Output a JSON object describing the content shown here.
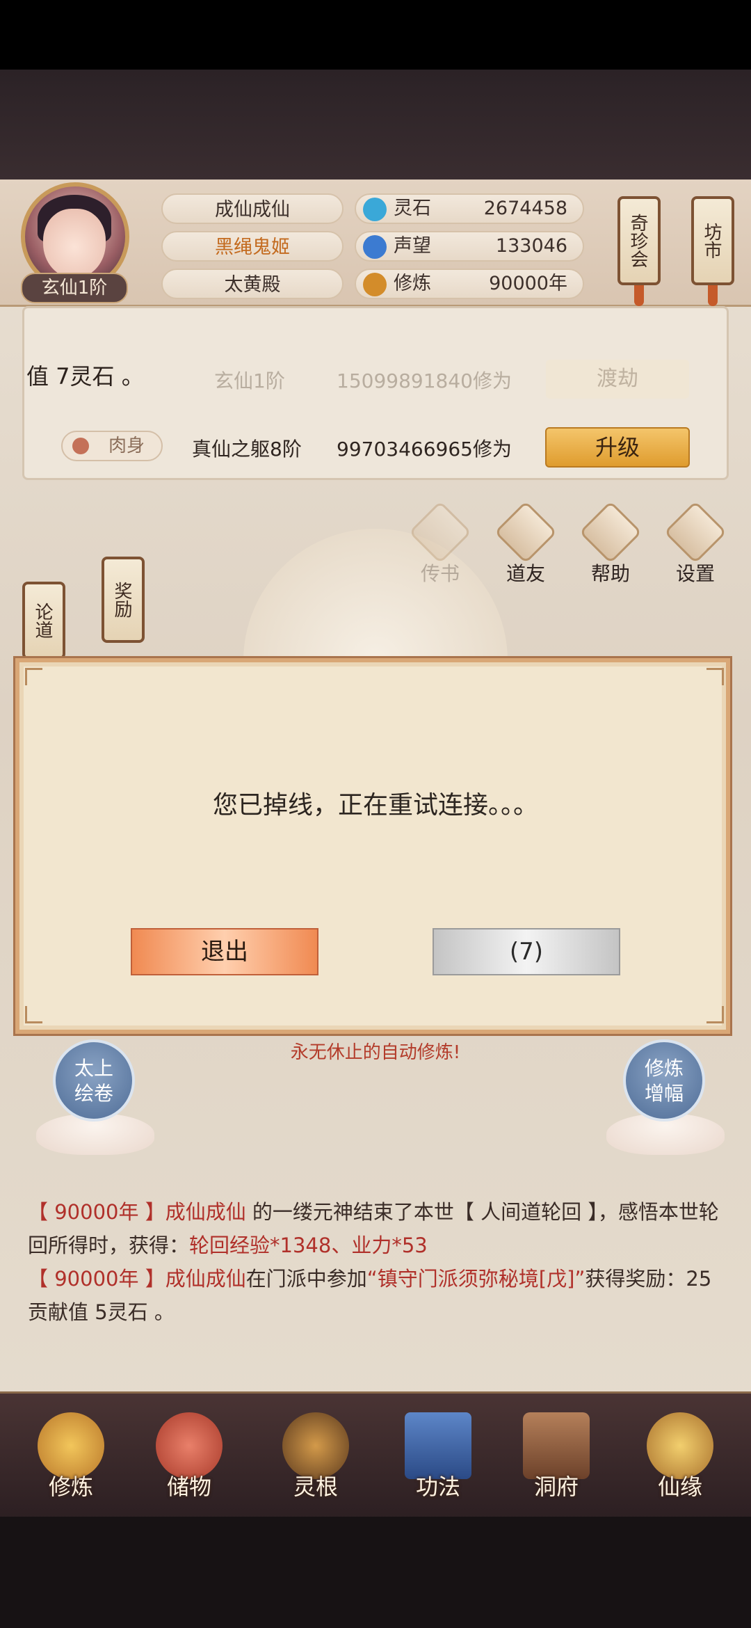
{
  "profile": {
    "realm": "玄仙1阶",
    "name": "成仙成仙",
    "title": "黑绳鬼姬",
    "sect": "太黄殿"
  },
  "stats": [
    {
      "label": "灵石",
      "value": "2674458",
      "icon": "spirit-stone-icon",
      "color": "#3aa8d8"
    },
    {
      "label": "声望",
      "value": "133046",
      "icon": "reputation-icon",
      "color": "#3c7bd1"
    },
    {
      "label": "修炼",
      "value": "90000年",
      "icon": "meditation-icon",
      "color": "#d38c2a"
    }
  ],
  "side_scrolls": {
    "qizhenhui": "奇珍会",
    "fangshi": "坊市",
    "lundao": "论道",
    "jiangli": "奖励"
  },
  "cultivation": {
    "overlay_text": "值 7灵石 。",
    "realm_stage": "玄仙1阶",
    "realm_exp": "15099891840修为",
    "dujie_label": "渡劫",
    "body_label": "肉身",
    "body_stage": "真仙之躯8阶",
    "body_exp": "99703466965修为",
    "upgrade_label": "升级"
  },
  "functions": [
    {
      "label": "传书",
      "icon": "letter-icon"
    },
    {
      "label": "道友",
      "icon": "friends-icon"
    },
    {
      "label": "帮助",
      "icon": "help-icon"
    },
    {
      "label": "设置",
      "icon": "settings-icon"
    }
  ],
  "lotus_buttons": {
    "left": "太上\n绘卷",
    "right": "修炼\n增幅"
  },
  "auto_cultivate_text": "永无休止的自动修炼!",
  "log": {
    "line1_year": "【 90000年 】",
    "line1_name": "成仙成仙",
    "line1_text_a": " 的一缕元神结束了本世【 人间道轮回 】，感悟本世轮回所得时，获得：",
    "line1_reward": "轮回经验*1348、业力*53",
    "line2_year": "【 90000年 】",
    "line2_name": "成仙成仙",
    "line2_text_a": "在门派中参加",
    "line2_event": "“镇守门派须弥秘境[戊]”",
    "line2_text_b": "获得奖励：25贡献值 5灵石 。"
  },
  "nav": [
    {
      "label": "修炼",
      "icon": "cultivate-icon",
      "color": "#d9a040"
    },
    {
      "label": "储物",
      "icon": "storage-bag-icon",
      "color": "#c9563a"
    },
    {
      "label": "灵根",
      "icon": "spirit-root-icon",
      "color": "#a96b2a"
    },
    {
      "label": "功法",
      "icon": "skill-book-icon",
      "color": "#3b5fa8"
    },
    {
      "label": "洞府",
      "icon": "cave-house-icon",
      "color": "#8a5a3a"
    },
    {
      "label": "仙缘",
      "icon": "fortune-icon",
      "color": "#d19a3a"
    }
  ],
  "dialog": {
    "message": "您已掉线，正在重试连接。。。",
    "exit_label": "退出",
    "retry_label": "(7)"
  }
}
